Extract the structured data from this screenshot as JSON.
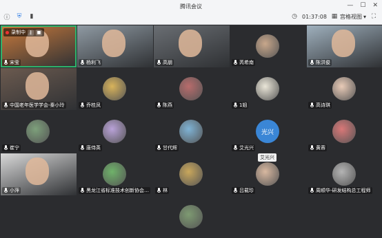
{
  "window": {
    "title": "腾讯会议"
  },
  "status": {
    "timer": "01:37:08",
    "view_label": "宫格视图"
  },
  "recording": {
    "label": "录制中"
  },
  "tooltip": {
    "text": "艾光兴"
  },
  "participants": [
    {
      "name": "宋莹",
      "avatar": "video",
      "color": "#c97a3c",
      "recording": true
    },
    {
      "name": "杨利飞",
      "avatar": "video",
      "color": "#8f9aa3"
    },
    {
      "name": "高朋",
      "avatar": "video",
      "color": "#6a6e73"
    },
    {
      "name": "芮希南",
      "avatar": "photo-icon",
      "color": "#c8a78b"
    },
    {
      "name": "陈洪俊",
      "avatar": "video",
      "color": "#9fb0bd"
    },
    {
      "name": "中国老年医学学会-秦小玲",
      "avatar": "video",
      "color": "#6b5a4f"
    },
    {
      "name": "乔桂凤",
      "avatar": "photo-icon",
      "color": "#d8b35b"
    },
    {
      "name": "陈燕",
      "avatar": "photo-icon",
      "color": "#b86c6c"
    },
    {
      "name": "1姐",
      "avatar": "photo-icon",
      "color": "#eae6d8"
    },
    {
      "name": "高诗琪",
      "avatar": "photo-icon",
      "color": "#e9cbb7"
    },
    {
      "name": "崔宁",
      "avatar": "photo-icon",
      "color": "#7da07b"
    },
    {
      "name": "唐侍英",
      "avatar": "photo-icon",
      "color": "#b9a2d8"
    },
    {
      "name": "甘代辉",
      "avatar": "photo-icon",
      "color": "#7fb3d5"
    },
    {
      "name": "艾光兴",
      "avatar": "text-avatar",
      "color": "#3a86d6",
      "text": "光兴"
    },
    {
      "name": "黄蓉",
      "avatar": "photo-icon",
      "color": "#d97878"
    },
    {
      "name": "小萍",
      "avatar": "video",
      "color": "#d9d9d9"
    },
    {
      "name": "黑龙江省标准技术创新协会…",
      "avatar": "photo-icon",
      "color": "#6fb26a"
    },
    {
      "name": "林",
      "avatar": "photo-icon",
      "color": "#c9a75c"
    },
    {
      "name": "吕载珍",
      "avatar": "photo-icon",
      "color": "#d8b8a0"
    },
    {
      "name": "周顺华-研发结构总工程师",
      "avatar": "photo-icon",
      "color": "#b4b4b4"
    },
    {
      "name": "",
      "avatar": "photo-icon",
      "color": "#7e9a72"
    }
  ]
}
